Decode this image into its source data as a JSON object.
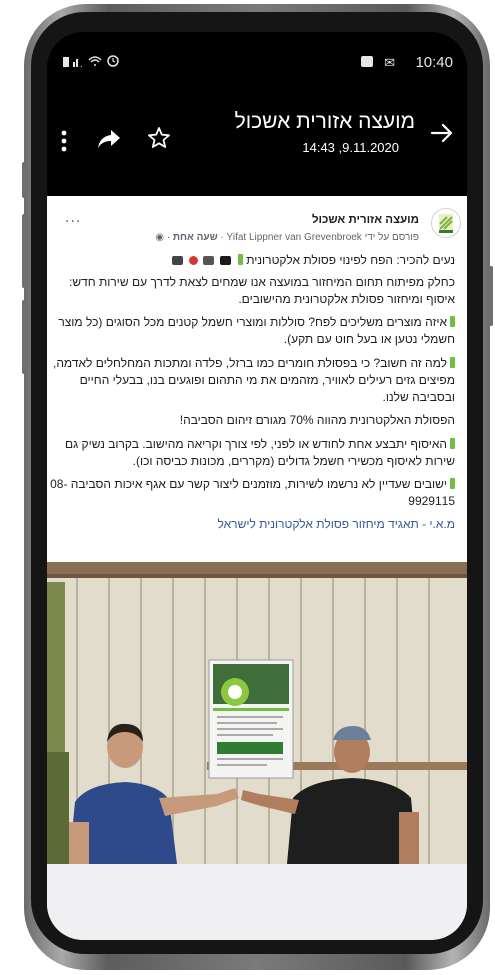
{
  "status_bar": {
    "time": "10:40",
    "left_icons": [
      "battery-icon",
      "signal-icon",
      "wifi-icon",
      "alarm-icon"
    ],
    "right_icons": [
      "mail-icon",
      "notification-icon"
    ]
  },
  "header": {
    "title": "מועצה אזורית אשכול",
    "subtitle": "14:43 ,9.11.2020",
    "icons": [
      "back-arrow-icon",
      "star-icon",
      "share-icon",
      "more-vert-icon"
    ]
  },
  "post": {
    "page_name": "מועצה אזורית אשכול",
    "meta_prefix": "פורסם על ידי",
    "author": "Yifat Lippner van Grevenbroek",
    "time_ago": "שעה אחת",
    "more": "...",
    "line1": "נעים להכיר: הפח לפינוי פסולת אלקטרונית",
    "p1": "כחלק מפיתוח תחום המיחזור במועצה אנו שמחים לצאת לדרך עם שירות חדש: איסוף ומיחזור פסולת אלקטרונית מהישובים.",
    "p2": "איזה מוצרים משליכים לפח? סוללות ומוצרי חשמל קטנים מכל הסוגים (כל מוצר חשמלי נטען או בעל חוט עם תקע).",
    "p3": "למה זה חשוב? כי בפסולת חומרים כמו ברזל, פלדה ומתכות המחלחלים לאדמה, מפיצים גזים רעילים לאוויר, מזהמים את מי התהום ופוגעים בנו, בבעלי החיים ובסביבה שלנו.",
    "p4": "הפסולת האלקטרונית מהווה 70% מגורם זיהום הסביבה!",
    "p5": "האיסוף יתבצע אחת לחודש או לפני, לפי צורך וקריאה מהישוב. בקרוב נשיק גם שירות לאיסוף מכשירי חשמל גדולים (מקררים, מכונות כביסה וכו).",
    "p6": "ישובים שעדיין לא נרשמו לשירות, מוזמנים ליצור קשר עם אגף איכות הסביבה 08-9929115",
    "tag": "מ.א.י - תאגיד מיחזור פסולת אלקטרונית לישראל",
    "photo_desc_icon": "photo-image"
  },
  "colors": {
    "accent_green": "#6fbf44",
    "link_blue": "#385898",
    "background_dark": "#000000"
  }
}
